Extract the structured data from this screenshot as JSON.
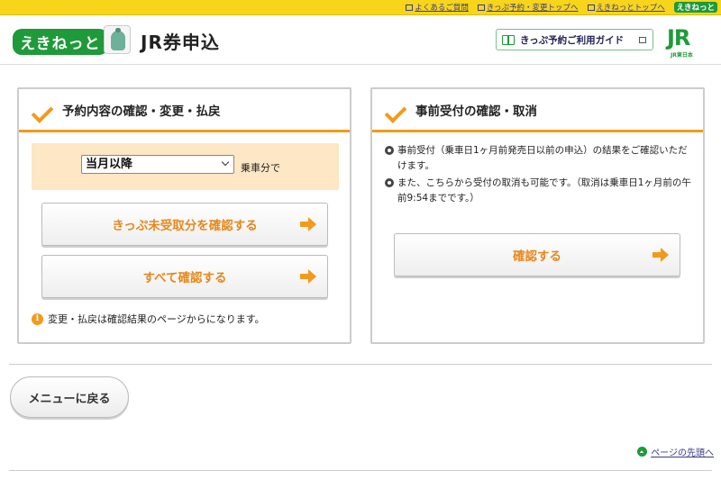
{
  "topbar": {
    "links": [
      "よくあるご質問",
      "きっぷ予約・変更トップへ",
      "えきねっとトップへ"
    ],
    "logo_small": "えきねっと"
  },
  "header": {
    "logo": "えきねっと",
    "title": "JR券申込",
    "guide_button": "きっぷ予約ご利用ガイド",
    "jr_logo": "JR",
    "jr_sub": "JR東日本"
  },
  "left_panel": {
    "title": "予約内容の確認・変更・払戻",
    "select_value": "当月以降",
    "select_suffix": "乗車分で",
    "btn_unreceived": "きっぷ未受取分を確認する",
    "btn_all": "すべて確認する",
    "note": "変更・払戻は確認結果のページからになります。"
  },
  "right_panel": {
    "title": "事前受付の確認・取消",
    "bullets": [
      "事前受付（乗車日1ヶ月前発売日以前の申込）の結果をご確認いただけます。",
      "また、こちらから受付の取消も可能です。（取消は乗車日1ヶ月前の午前9:54までです。）"
    ],
    "btn_confirm": "確認する"
  },
  "footer": {
    "menu_button": "メニューに戻る",
    "page_top": "ページの先頭へ"
  },
  "colors": {
    "accent_orange": "#f39a1b",
    "brand_green": "#1e9a3a",
    "topbar_yellow": "#f7d51a"
  }
}
